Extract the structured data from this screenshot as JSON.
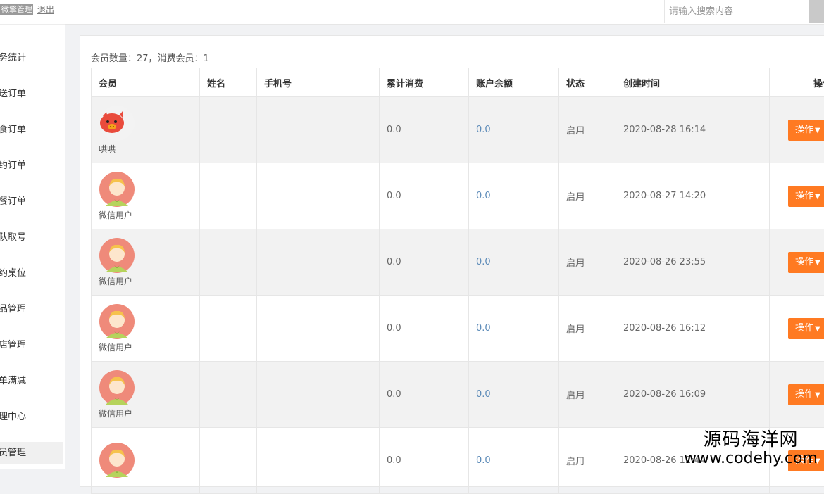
{
  "sidebar": {
    "admin_label": "微擎管理...",
    "logout_label": "退出",
    "items": [
      {
        "label": "务统计"
      },
      {
        "label": "送订单"
      },
      {
        "label": "食订单"
      },
      {
        "label": "约订单"
      },
      {
        "label": "餐订单"
      },
      {
        "label": "队取号"
      },
      {
        "label": "约桌位"
      },
      {
        "label": "品管理"
      },
      {
        "label": "店管理"
      },
      {
        "label": "单满减"
      },
      {
        "label": "理中心"
      },
      {
        "label": "员管理"
      }
    ]
  },
  "search": {
    "placeholder": "请输入搜索内容"
  },
  "summary": "会员数量：27，消费会员：1",
  "table": {
    "headers": [
      "会员",
      "姓名",
      "手机号",
      "累计消费",
      "账户余额",
      "状态",
      "创建时间",
      "操作"
    ],
    "rows": [
      {
        "member": "哄哄",
        "avatar": "pig-avatar-icon",
        "name": "",
        "phone": "",
        "spent": "0.0",
        "balance": "0.0",
        "status": "启用",
        "created": "2020-08-28 16:14",
        "action": "操作"
      },
      {
        "member": "微信用户",
        "avatar": "default-user-avatar-icon",
        "name": "",
        "phone": "",
        "spent": "0.0",
        "balance": "0.0",
        "status": "启用",
        "created": "2020-08-27 14:20",
        "action": "操作"
      },
      {
        "member": "微信用户",
        "avatar": "default-user-avatar-icon",
        "name": "",
        "phone": "",
        "spent": "0.0",
        "balance": "0.0",
        "status": "启用",
        "created": "2020-08-26 23:55",
        "action": "操作"
      },
      {
        "member": "微信用户",
        "avatar": "default-user-avatar-icon",
        "name": "",
        "phone": "",
        "spent": "0.0",
        "balance": "0.0",
        "status": "启用",
        "created": "2020-08-26 16:12",
        "action": "操作"
      },
      {
        "member": "微信用户",
        "avatar": "default-user-avatar-icon",
        "name": "",
        "phone": "",
        "spent": "0.0",
        "balance": "0.0",
        "status": "启用",
        "created": "2020-08-26 16:09",
        "action": "操作"
      },
      {
        "member": "",
        "avatar": "default-user-avatar-icon",
        "name": "",
        "phone": "",
        "spent": "0.0",
        "balance": "0.0",
        "status": "启用",
        "created": "2020-08-26 12:44",
        "action": "操作"
      }
    ]
  },
  "watermark": {
    "line1": "源码海洋网",
    "line2": "www.codehy.com"
  },
  "colors": {
    "action_button": "#ff7a22",
    "balance_text": "#5b8ab8",
    "row_alt": "#f2f2f2"
  }
}
